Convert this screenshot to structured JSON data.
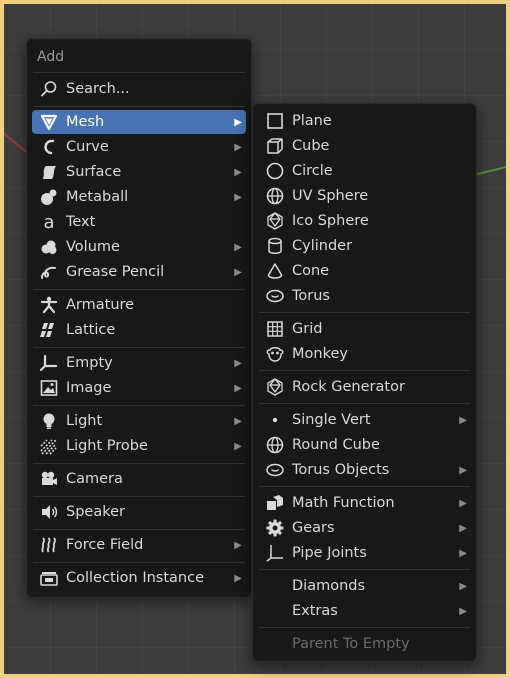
{
  "add_menu": {
    "title": "Add",
    "search_label": "Search...",
    "items": {
      "mesh": "Mesh",
      "curve": "Curve",
      "surface": "Surface",
      "metaball": "Metaball",
      "text": "Text",
      "volume": "Volume",
      "grease_pencil": "Grease Pencil",
      "armature": "Armature",
      "lattice": "Lattice",
      "empty": "Empty",
      "image": "Image",
      "light": "Light",
      "light_probe": "Light Probe",
      "camera": "Camera",
      "speaker": "Speaker",
      "force_field": "Force Field",
      "collection_instance": "Collection Instance"
    },
    "submenu_arrow": "▶"
  },
  "mesh_menu": {
    "items": {
      "plane": "Plane",
      "cube": "Cube",
      "circle": "Circle",
      "uv_sphere": "UV Sphere",
      "ico_sphere": "Ico Sphere",
      "cylinder": "Cylinder",
      "cone": "Cone",
      "torus": "Torus",
      "grid": "Grid",
      "monkey": "Monkey",
      "rock_generator": "Rock Generator",
      "single_vert": "Single Vert",
      "round_cube": "Round Cube",
      "torus_objects": "Torus Objects",
      "math_function": "Math Function",
      "gears": "Gears",
      "pipe_joints": "Pipe Joints",
      "diamonds": "Diamonds",
      "extras": "Extras",
      "parent_to_empty": "Parent To Empty"
    },
    "submenu_arrow": "▶"
  },
  "colors": {
    "highlight": "#4772b3",
    "menu_bg": "#181818",
    "frame_border": "#f0d27e"
  }
}
